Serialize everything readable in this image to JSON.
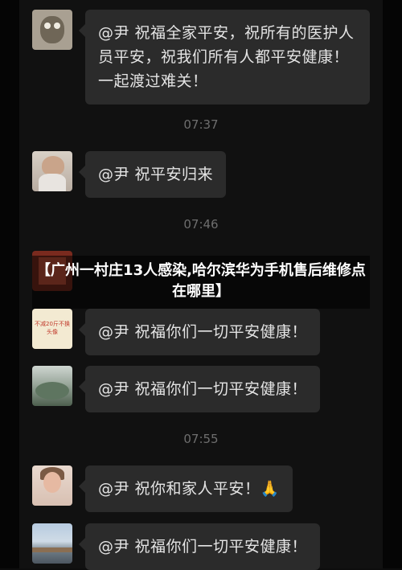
{
  "messages": [
    {
      "avatar": "owl-avatar",
      "text": "@尹 祝福全家平安，祝所有的医护人员平安，祝我们所有人都平安健康！一起渡过难关！"
    },
    {
      "time": "07:37"
    },
    {
      "avatar": "girl-avatar",
      "text": "@尹 祝平安归来"
    },
    {
      "time": "07:46"
    },
    {
      "avatar": "text-avatar",
      "avatar_text": "不减20斤不换头像",
      "text": "@尹 祝福你们一切平安健康！"
    },
    {
      "avatar": "tree-avatar",
      "text": "@尹 祝福你们一切平安健康！"
    },
    {
      "time": "07:55"
    },
    {
      "avatar": "woman-avatar",
      "text": "@尹 祝你和家人平安！🙏"
    },
    {
      "avatar": "road-avatar",
      "text": "@尹 祝福你们一切平安健康！"
    }
  ],
  "overlay": {
    "caption": "【广州一村庄13人感染,哈尔滨华为手机售后维修点在哪里】"
  }
}
